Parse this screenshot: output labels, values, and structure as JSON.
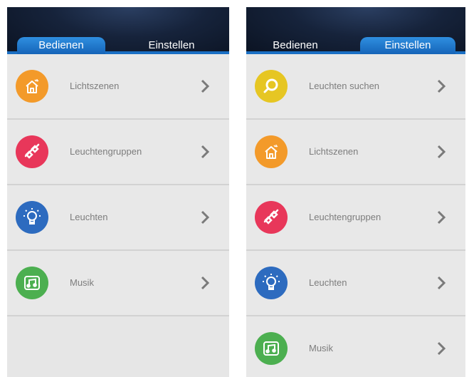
{
  "left_screen": {
    "tabs": [
      {
        "label": "Bedienen",
        "active": true
      },
      {
        "label": "Einstellen",
        "active": false
      }
    ],
    "items": [
      {
        "label": "Lichtszenen",
        "icon": "house-icon",
        "color": "#f39a2a"
      },
      {
        "label": "Leuchtengruppen",
        "icon": "link-icon",
        "color": "#e8375a"
      },
      {
        "label": "Leuchten",
        "icon": "bulb-icon",
        "color": "#2d6bbf"
      },
      {
        "label": "Musik",
        "icon": "music-icon",
        "color": "#4caf50"
      }
    ]
  },
  "right_screen": {
    "tabs": [
      {
        "label": "Bedienen",
        "active": false
      },
      {
        "label": "Einstellen",
        "active": true
      }
    ],
    "items": [
      {
        "label": "Leuchten suchen",
        "icon": "search-icon",
        "color": "#e6c623"
      },
      {
        "label": "Lichtszenen",
        "icon": "house-icon",
        "color": "#f39a2a"
      },
      {
        "label": "Leuchtengruppen",
        "icon": "link-icon",
        "color": "#e8375a"
      },
      {
        "label": "Leuchten",
        "icon": "bulb-icon",
        "color": "#2d6bbf"
      },
      {
        "label": "Musik",
        "icon": "music-icon",
        "color": "#4caf50"
      }
    ]
  }
}
